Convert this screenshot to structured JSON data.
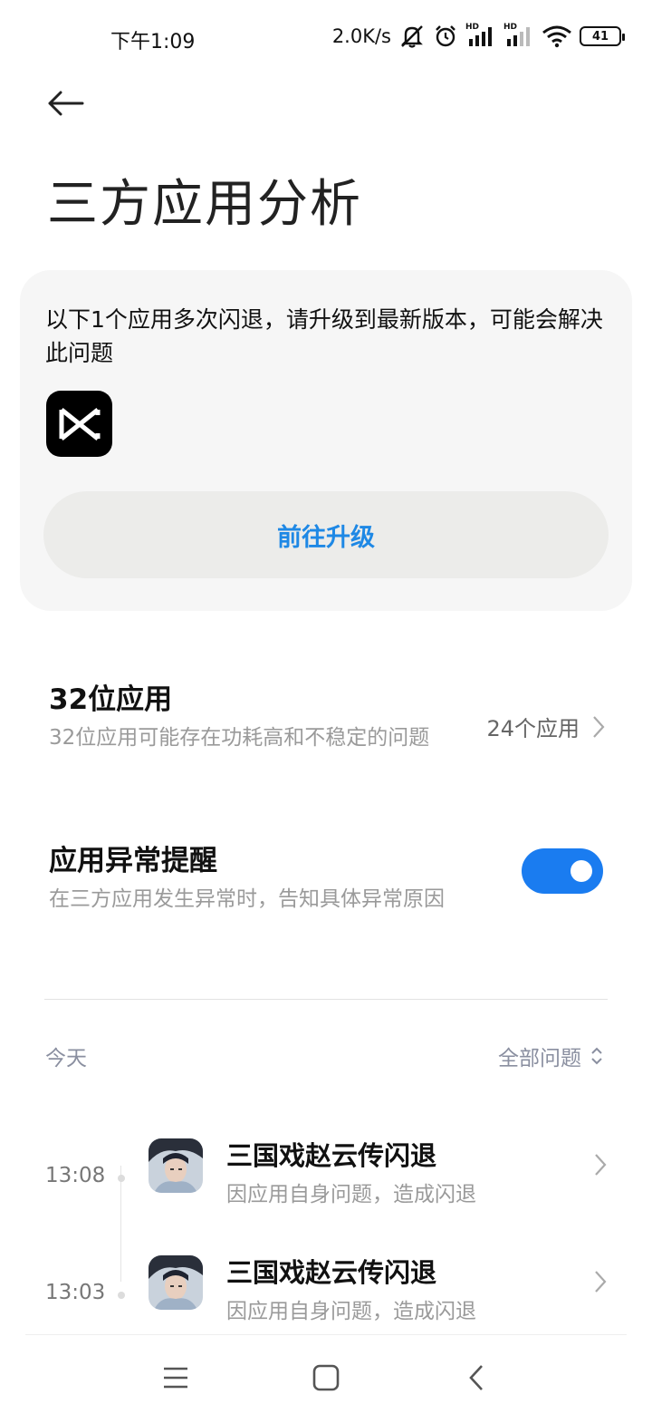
{
  "status_bar": {
    "time": "下午1:09",
    "speed": "2.0K/s",
    "hd1": "HD",
    "hd2": "HD",
    "battery": "41"
  },
  "header": {
    "title": "三方应用分析"
  },
  "upgrade_card": {
    "message": "以下1个应用多次闪退，请升级到最新版本，可能会解决此问题",
    "app_icon": "capcut-icon",
    "button_label": "前往升级"
  },
  "settings": {
    "bit32": {
      "title": "32位应用",
      "description": "32位应用可能存在功耗高和不稳定的问题",
      "value": "24个应用"
    },
    "alert": {
      "title": "应用异常提醒",
      "description": "在三方应用发生异常时，告知具体异常原因",
      "enabled": true
    }
  },
  "list_header": {
    "date": "今天",
    "filter": "全部问题"
  },
  "events": [
    {
      "time": "13:08",
      "title": "三国戏赵云传闪退",
      "subtitle": "因应用自身问题，造成闪退"
    },
    {
      "time": "13:03",
      "title": "三国戏赵云传闪退",
      "subtitle": "因应用自身问题，造成闪退"
    }
  ],
  "colors": {
    "accent": "#1a7cf0",
    "link": "#1e88e5",
    "card_bg": "#f6f6f6"
  }
}
